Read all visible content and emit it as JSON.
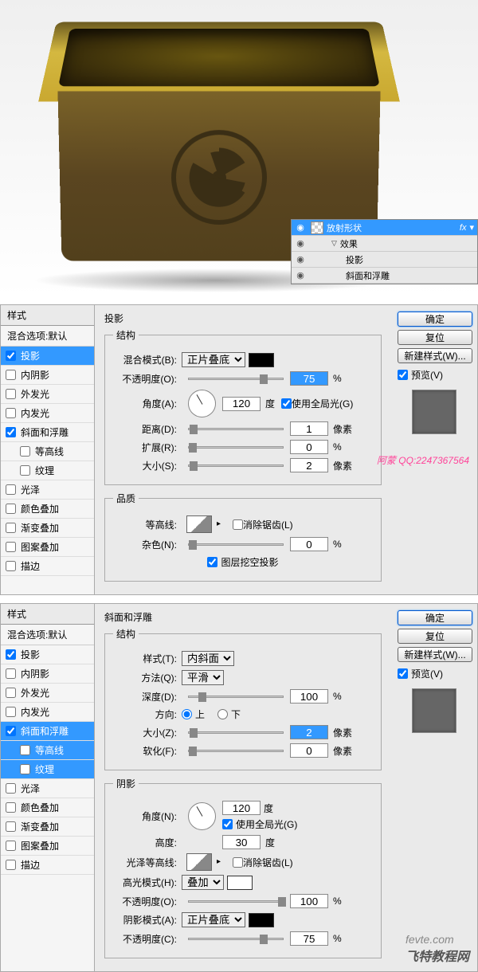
{
  "layers": {
    "selected": "放射形状",
    "fx_label": "fx",
    "effects": "效果",
    "effect1": "投影",
    "effect2": "斜面和浮雕"
  },
  "styles": {
    "header": "样式",
    "blend_default": "混合选项:默认",
    "drop_shadow": "投影",
    "inner_shadow": "内阴影",
    "outer_glow": "外发光",
    "inner_glow": "内发光",
    "bevel": "斜面和浮雕",
    "contour": "等高线",
    "texture": "纹理",
    "satin": "光泽",
    "color_overlay": "颜色叠加",
    "gradient_overlay": "渐变叠加",
    "pattern_overlay": "图案叠加",
    "stroke": "描边"
  },
  "buttons": {
    "ok": "确定",
    "cancel": "复位",
    "new_style": "新建样式(W)...",
    "preview": "预览(V)"
  },
  "shadow_panel": {
    "title": "投影",
    "structure": "结构",
    "blend_mode": "混合模式(B):",
    "blend_mode_val": "正片叠底",
    "opacity": "不透明度(O):",
    "opacity_val": "75",
    "angle": "角度(A):",
    "angle_val": "120",
    "angle_unit": "度",
    "global_light": "使用全局光(G)",
    "distance": "距离(D):",
    "distance_val": "1",
    "spread": "扩展(R):",
    "spread_val": "0",
    "size": "大小(S):",
    "size_val": "2",
    "px": "像素",
    "pct": "%",
    "quality": "品质",
    "contour_label": "等高线:",
    "antialias": "消除锯齿(L)",
    "noise": "杂色(N):",
    "noise_val": "0",
    "knockout": "图层挖空投影"
  },
  "bevel_panel": {
    "title": "斜面和浮雕",
    "structure": "结构",
    "style": "样式(T):",
    "style_val": "内斜面",
    "technique": "方法(Q):",
    "technique_val": "平滑",
    "depth": "深度(D):",
    "depth_val": "100",
    "direction": "方向:",
    "dir_up": "上",
    "dir_down": "下",
    "size": "大小(Z):",
    "size_val": "2",
    "soften": "软化(F):",
    "soften_val": "0",
    "px": "像素",
    "pct": "%",
    "shading": "阴影",
    "angle": "角度(N):",
    "angle_val": "120",
    "angle_unit": "度",
    "global_light": "使用全局光(G)",
    "altitude": "高度:",
    "altitude_val": "30",
    "gloss_contour": "光泽等高线:",
    "antialias": "消除锯齿(L)",
    "highlight_mode": "高光模式(H):",
    "highlight_mode_val": "叠加",
    "highlight_opacity": "不透明度(O):",
    "highlight_opacity_val": "100",
    "shadow_mode": "阴影模式(A):",
    "shadow_mode_val": "正片叠底",
    "shadow_opacity": "不透明度(C):",
    "shadow_opacity_val": "75"
  },
  "watermark": "阿蒙 QQ:2247367564",
  "bottom_mark1": "fevte.com",
  "bottom_mark2": "飞特教程网"
}
